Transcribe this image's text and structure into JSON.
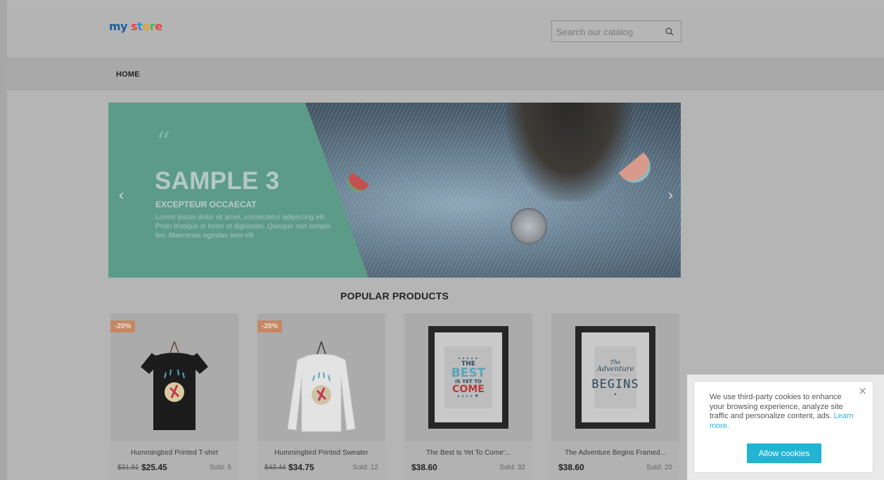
{
  "header": {
    "logo": {
      "my": "my",
      "store": "store",
      "my_color": "#1f5f9a",
      "store_letters": [
        "s",
        "t",
        "o",
        "r",
        "e"
      ],
      "store_colors": [
        "#e04545",
        "#2f8fd4",
        "#e3a12a",
        "#4db357",
        "#e04545"
      ]
    },
    "search": {
      "placeholder": "Search our catalog",
      "value": ""
    }
  },
  "nav": {
    "items": [
      {
        "label": "HOME"
      }
    ]
  },
  "slider": {
    "quote_mark": "“",
    "title": "SAMPLE 3",
    "subtitle": "EXCEPTEUR OCCAECAT",
    "text": "Lorem ipsum dolor sit amet, consectetur adipiscing elit. Proin tristique in tortor et dignissim. Quisque non tempor leo. Maecenas egestas sem elit",
    "prev_icon": "‹",
    "next_icon": "›",
    "panel_color": "#5d9b89"
  },
  "popular": {
    "title": "POPULAR PRODUCTS",
    "products": [
      {
        "name": "Hummingbird Printed T-shirt",
        "badge": "-20%",
        "old_price": "$31.81",
        "price": "$25.45",
        "sold": "Sold: 6",
        "image": "black-tshirt"
      },
      {
        "name": "Hummingbird Printed Sweater",
        "badge": "-20%",
        "old_price": "$43.44",
        "price": "$34.75",
        "sold": "Sold: 12",
        "image": "white-sweater"
      },
      {
        "name": "The Best Is Yet To Come'...",
        "badge": "",
        "old_price": "",
        "price": "$38.60",
        "sold": "Sold: 32",
        "image": "framed-poster-best"
      },
      {
        "name": "The Adventure Begins Framed...",
        "badge": "",
        "old_price": "",
        "price": "$38.60",
        "sold": "Sold: 20",
        "image": "framed-poster-adventure"
      }
    ],
    "poster_best": {
      "line1": "THE",
      "line2": "BEST",
      "line3": "IS YET TO",
      "line4": "COME"
    },
    "poster_adventure": {
      "line1": "The",
      "line2": "Adventure",
      "line3": "BEGINS"
    }
  },
  "cookie": {
    "text": "We use third-party cookies to enhance your browsing experience, analyze site traffic and personalize content, ads.",
    "link": "Learn more.",
    "button": "Allow cookies",
    "close_icon": "×",
    "accent": "#22b4d2"
  }
}
